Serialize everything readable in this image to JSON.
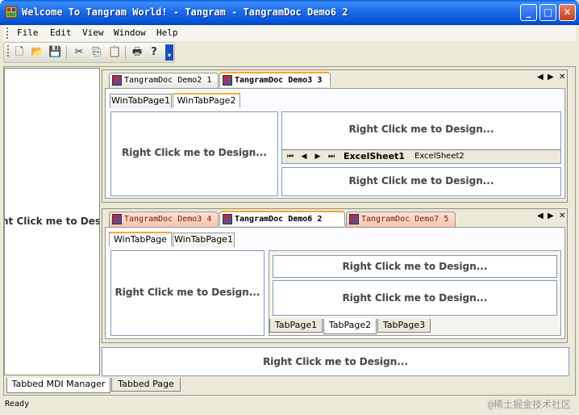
{
  "window": {
    "title": "Welcome To Tangram World! - Tangram - TangramDoc Demo6 2",
    "controls": {
      "minimize": "_",
      "maximize": "□",
      "close": "✕"
    }
  },
  "menu": [
    "File",
    "Edit",
    "View",
    "Window",
    "Help"
  ],
  "toolbar": {
    "icons": [
      "new-icon",
      "open-icon",
      "save-icon",
      "cut-icon",
      "copy-icon",
      "paste-icon",
      "print-icon",
      "help-icon"
    ],
    "glyphs": [
      "🗋",
      "📂",
      "💾",
      "✂",
      "⎘",
      "📋",
      "🖶",
      "?"
    ]
  },
  "design_prompt": "Right Click me to Design...",
  "left_pane_label": "Right Click me to Design...",
  "top_group": {
    "tabs": [
      "TangramDoc Demo2 1",
      "TangramDoc Demo3 3"
    ],
    "active_index": 1,
    "nav": [
      "◀",
      "▶",
      "✕"
    ],
    "win_tabs": [
      "WinTabPage1",
      "WinTabPage2"
    ],
    "win_active_index": 1,
    "sheet_tabs": [
      "ExcelSheet1",
      "ExcelSheet2"
    ],
    "sheet_nav": [
      "⏮",
      "◀",
      "▶",
      "⏭"
    ]
  },
  "bottom_group": {
    "tabs": [
      "TangramDoc Demo3 4",
      "TangramDoc Demo6 2",
      "TangramDoc Demo7 5"
    ],
    "active_index": 1,
    "nav": [
      "◀",
      "▶",
      "✕"
    ],
    "win_tabs": [
      "WinTabPage",
      "WinTabPage1"
    ],
    "win_active_index": 0,
    "page_tabs": [
      "TabPage1",
      "TabPage2",
      "TabPage3"
    ],
    "page_active_index": 1
  },
  "mdi_tabs": [
    "Tabbed MDI Manager",
    "Tabbed Page"
  ],
  "status": {
    "text": "Ready",
    "watermark": "@稀土掘金技术社区"
  }
}
